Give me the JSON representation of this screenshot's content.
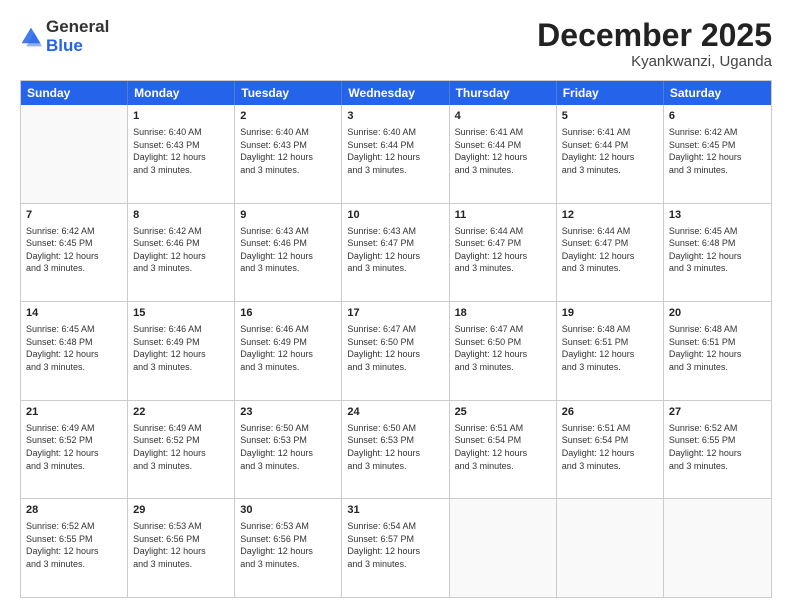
{
  "header": {
    "logo_general": "General",
    "logo_blue": "Blue",
    "month_title": "December 2025",
    "location": "Kyankwanzi, Uganda"
  },
  "days_of_week": [
    "Sunday",
    "Monday",
    "Tuesday",
    "Wednesday",
    "Thursday",
    "Friday",
    "Saturday"
  ],
  "weeks": [
    [
      {
        "day": "",
        "info": ""
      },
      {
        "day": "1",
        "info": "Sunrise: 6:40 AM\nSunset: 6:43 PM\nDaylight: 12 hours\nand 3 minutes."
      },
      {
        "day": "2",
        "info": "Sunrise: 6:40 AM\nSunset: 6:43 PM\nDaylight: 12 hours\nand 3 minutes."
      },
      {
        "day": "3",
        "info": "Sunrise: 6:40 AM\nSunset: 6:44 PM\nDaylight: 12 hours\nand 3 minutes."
      },
      {
        "day": "4",
        "info": "Sunrise: 6:41 AM\nSunset: 6:44 PM\nDaylight: 12 hours\nand 3 minutes."
      },
      {
        "day": "5",
        "info": "Sunrise: 6:41 AM\nSunset: 6:44 PM\nDaylight: 12 hours\nand 3 minutes."
      },
      {
        "day": "6",
        "info": "Sunrise: 6:42 AM\nSunset: 6:45 PM\nDaylight: 12 hours\nand 3 minutes."
      }
    ],
    [
      {
        "day": "7",
        "info": "Sunrise: 6:42 AM\nSunset: 6:45 PM\nDaylight: 12 hours\nand 3 minutes."
      },
      {
        "day": "8",
        "info": "Sunrise: 6:42 AM\nSunset: 6:46 PM\nDaylight: 12 hours\nand 3 minutes."
      },
      {
        "day": "9",
        "info": "Sunrise: 6:43 AM\nSunset: 6:46 PM\nDaylight: 12 hours\nand 3 minutes."
      },
      {
        "day": "10",
        "info": "Sunrise: 6:43 AM\nSunset: 6:47 PM\nDaylight: 12 hours\nand 3 minutes."
      },
      {
        "day": "11",
        "info": "Sunrise: 6:44 AM\nSunset: 6:47 PM\nDaylight: 12 hours\nand 3 minutes."
      },
      {
        "day": "12",
        "info": "Sunrise: 6:44 AM\nSunset: 6:47 PM\nDaylight: 12 hours\nand 3 minutes."
      },
      {
        "day": "13",
        "info": "Sunrise: 6:45 AM\nSunset: 6:48 PM\nDaylight: 12 hours\nand 3 minutes."
      }
    ],
    [
      {
        "day": "14",
        "info": "Sunrise: 6:45 AM\nSunset: 6:48 PM\nDaylight: 12 hours\nand 3 minutes."
      },
      {
        "day": "15",
        "info": "Sunrise: 6:46 AM\nSunset: 6:49 PM\nDaylight: 12 hours\nand 3 minutes."
      },
      {
        "day": "16",
        "info": "Sunrise: 6:46 AM\nSunset: 6:49 PM\nDaylight: 12 hours\nand 3 minutes."
      },
      {
        "day": "17",
        "info": "Sunrise: 6:47 AM\nSunset: 6:50 PM\nDaylight: 12 hours\nand 3 minutes."
      },
      {
        "day": "18",
        "info": "Sunrise: 6:47 AM\nSunset: 6:50 PM\nDaylight: 12 hours\nand 3 minutes."
      },
      {
        "day": "19",
        "info": "Sunrise: 6:48 AM\nSunset: 6:51 PM\nDaylight: 12 hours\nand 3 minutes."
      },
      {
        "day": "20",
        "info": "Sunrise: 6:48 AM\nSunset: 6:51 PM\nDaylight: 12 hours\nand 3 minutes."
      }
    ],
    [
      {
        "day": "21",
        "info": "Sunrise: 6:49 AM\nSunset: 6:52 PM\nDaylight: 12 hours\nand 3 minutes."
      },
      {
        "day": "22",
        "info": "Sunrise: 6:49 AM\nSunset: 6:52 PM\nDaylight: 12 hours\nand 3 minutes."
      },
      {
        "day": "23",
        "info": "Sunrise: 6:50 AM\nSunset: 6:53 PM\nDaylight: 12 hours\nand 3 minutes."
      },
      {
        "day": "24",
        "info": "Sunrise: 6:50 AM\nSunset: 6:53 PM\nDaylight: 12 hours\nand 3 minutes."
      },
      {
        "day": "25",
        "info": "Sunrise: 6:51 AM\nSunset: 6:54 PM\nDaylight: 12 hours\nand 3 minutes."
      },
      {
        "day": "26",
        "info": "Sunrise: 6:51 AM\nSunset: 6:54 PM\nDaylight: 12 hours\nand 3 minutes."
      },
      {
        "day": "27",
        "info": "Sunrise: 6:52 AM\nSunset: 6:55 PM\nDaylight: 12 hours\nand 3 minutes."
      }
    ],
    [
      {
        "day": "28",
        "info": "Sunrise: 6:52 AM\nSunset: 6:55 PM\nDaylight: 12 hours\nand 3 minutes."
      },
      {
        "day": "29",
        "info": "Sunrise: 6:53 AM\nSunset: 6:56 PM\nDaylight: 12 hours\nand 3 minutes."
      },
      {
        "day": "30",
        "info": "Sunrise: 6:53 AM\nSunset: 6:56 PM\nDaylight: 12 hours\nand 3 minutes."
      },
      {
        "day": "31",
        "info": "Sunrise: 6:54 AM\nSunset: 6:57 PM\nDaylight: 12 hours\nand 3 minutes."
      },
      {
        "day": "",
        "info": ""
      },
      {
        "day": "",
        "info": ""
      },
      {
        "day": "",
        "info": ""
      }
    ]
  ]
}
